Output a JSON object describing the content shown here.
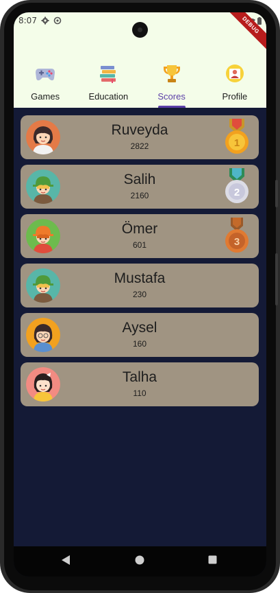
{
  "status_bar": {
    "time": "8:07",
    "debug_banner": "DEBUG"
  },
  "tabs": [
    {
      "label": "Games",
      "icon": "gamepad-icon",
      "active": false
    },
    {
      "label": "Education",
      "icon": "books-icon",
      "active": false
    },
    {
      "label": "Scores",
      "icon": "trophy-icon",
      "active": true
    },
    {
      "label": "Profile",
      "icon": "profile-card-icon",
      "active": false
    }
  ],
  "leaderboard": [
    {
      "name": "Ruveyda",
      "score": "2822",
      "avatar": "girl-avatar-icon",
      "medal": "gold-medal-icon",
      "medal_number": "1"
    },
    {
      "name": "Salih",
      "score": "2160",
      "avatar": "boy-green-hat-avatar-icon",
      "medal": "silver-medal-icon",
      "medal_number": "2"
    },
    {
      "name": "Ömer",
      "score": "601",
      "avatar": "boy-orange-hat-avatar-icon",
      "medal": "bronze-medal-icon",
      "medal_number": "3"
    },
    {
      "name": "Mustafa",
      "score": "230",
      "avatar": "boy-green-hat-avatar-icon"
    },
    {
      "name": "Aysel",
      "score": "160",
      "avatar": "girl-glasses-avatar-icon"
    },
    {
      "name": "Talha",
      "score": "110",
      "avatar": "girl-bow-avatar-icon"
    }
  ],
  "colors": {
    "header_bg": "#f4fde9",
    "body_bg": "#141a36",
    "card_bg": "#a09482",
    "active_tab": "#5b3fa8"
  }
}
